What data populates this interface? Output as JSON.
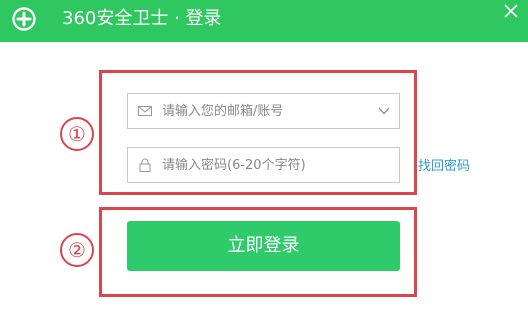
{
  "window": {
    "brand": "360安全卫士 · 登录"
  },
  "form": {
    "account_placeholder": "请输入您的邮箱/账号",
    "password_placeholder": "请输入密码(6-20个字符)",
    "find_password": "找回密码",
    "login_button": "立即登录"
  },
  "annotations": [
    "①",
    "②"
  ],
  "colors": {
    "title_bar": "#2fc860",
    "login_button": "#2fcb6b",
    "annotation": "#d9464b",
    "link": "#2b9cd8"
  },
  "icons": {
    "logo": "360-logo-icon",
    "close": "close-icon",
    "account": "envelope-icon",
    "dropdown": "chevron-down-icon",
    "password": "lock-icon"
  }
}
